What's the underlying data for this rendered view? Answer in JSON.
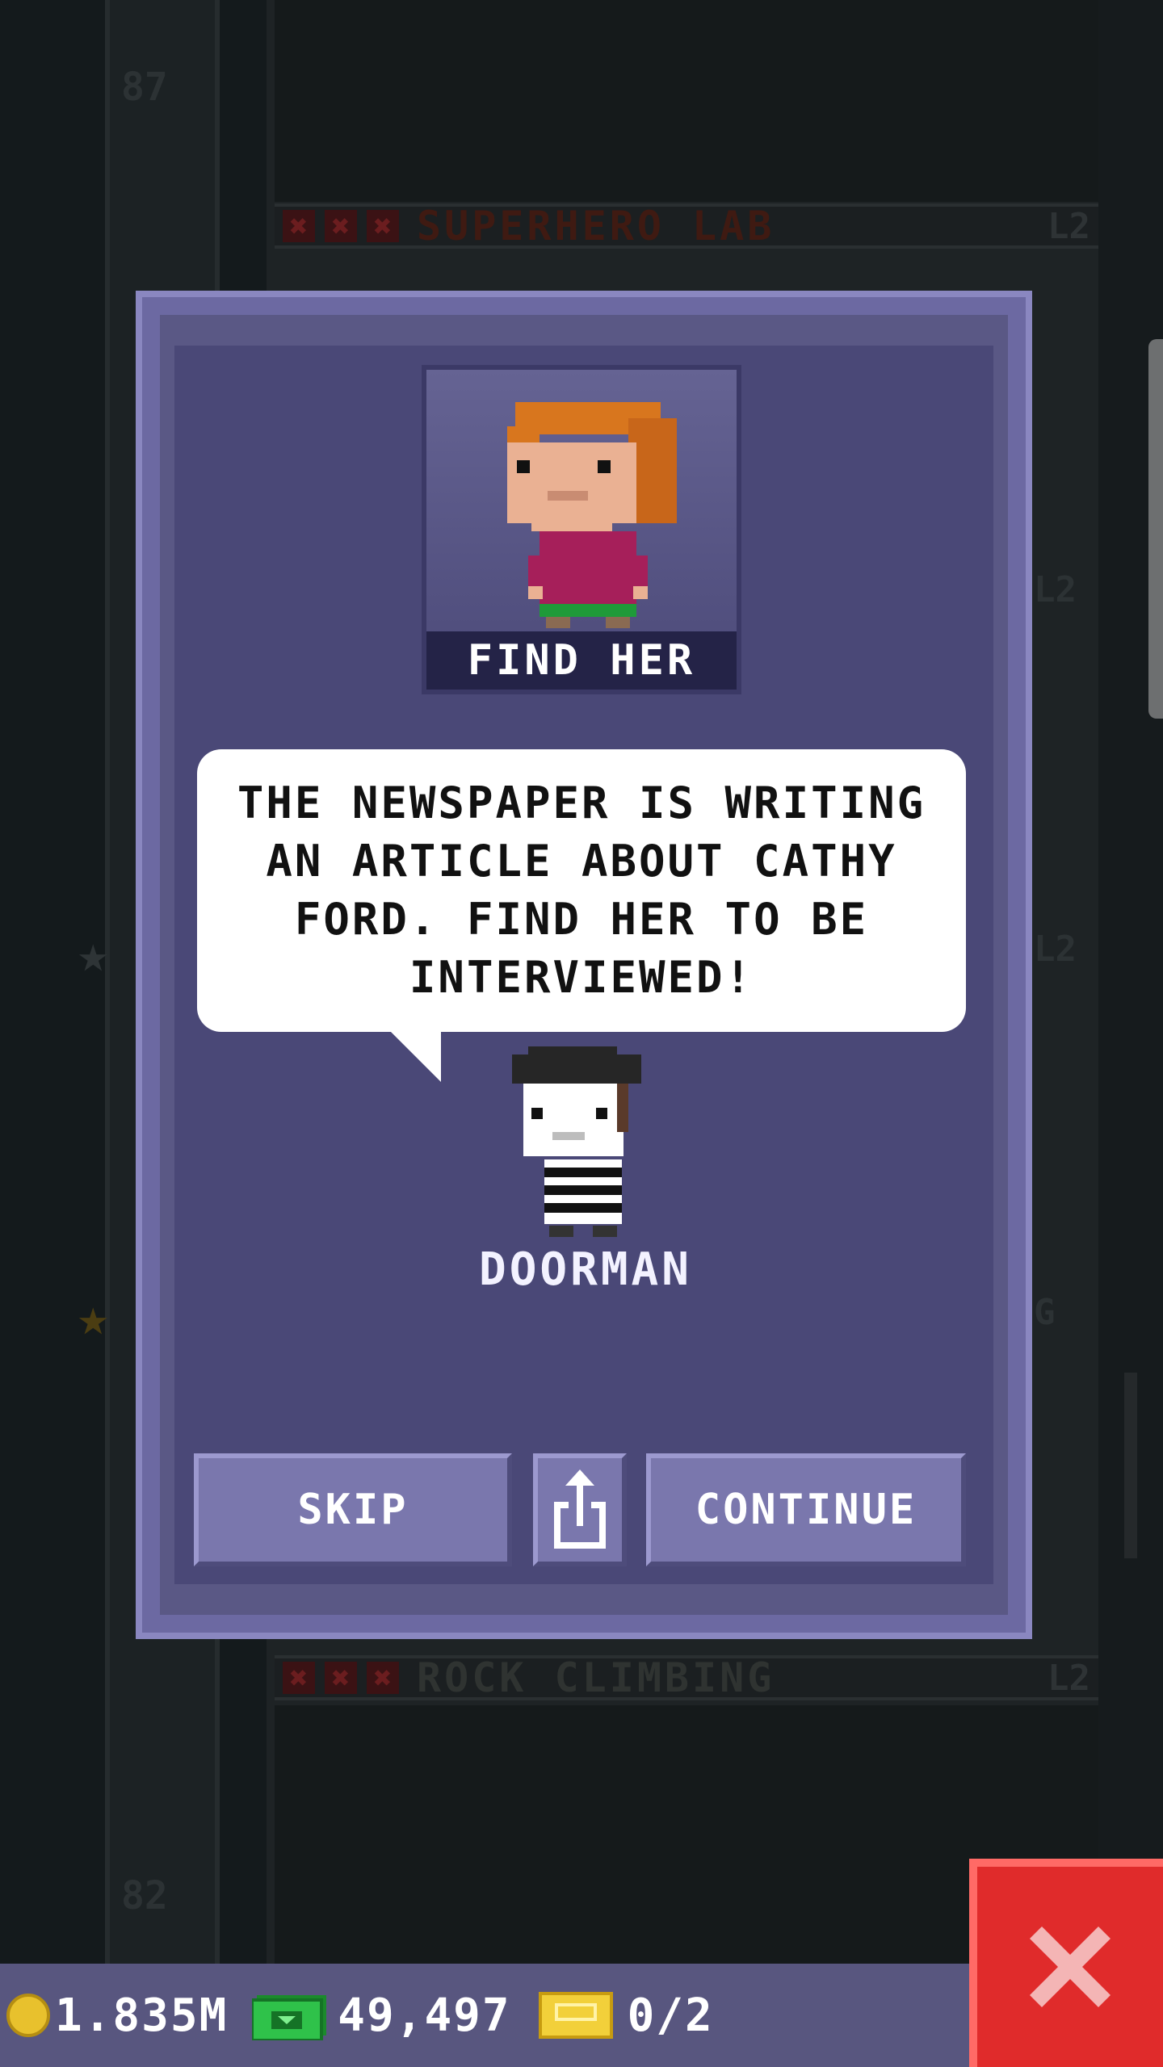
{
  "background": {
    "floors": [
      {
        "name": "SUPERHERO LAB",
        "level": "L2"
      },
      {
        "name": "ROCK CLIMBING",
        "level": "L2"
      }
    ],
    "floor_numbers": [
      "87",
      "82"
    ],
    "side_levels": [
      "L2",
      "L2",
      "G"
    ]
  },
  "dialog": {
    "portrait_label": "FIND HER",
    "message": "THE NEWSPAPER IS WRITING AN ARTICLE ABOUT CATHY FORD. FIND HER TO BE INTERVIEWED!",
    "npc_name": "DOORMAN",
    "buttons": {
      "skip": "SKIP",
      "continue": "CONTINUE",
      "share_icon": "share-icon"
    }
  },
  "status": {
    "coins": "1.835M",
    "bux": "49,497",
    "tickets": "0/2"
  },
  "icons": {
    "coin": "coin-icon",
    "bux": "bux-icon",
    "ticket": "ticket-icon",
    "close": "close-icon"
  },
  "colors": {
    "dialog_bg": "#4a4877",
    "button": "#7a77ad",
    "close_button": "#e02b2b"
  }
}
